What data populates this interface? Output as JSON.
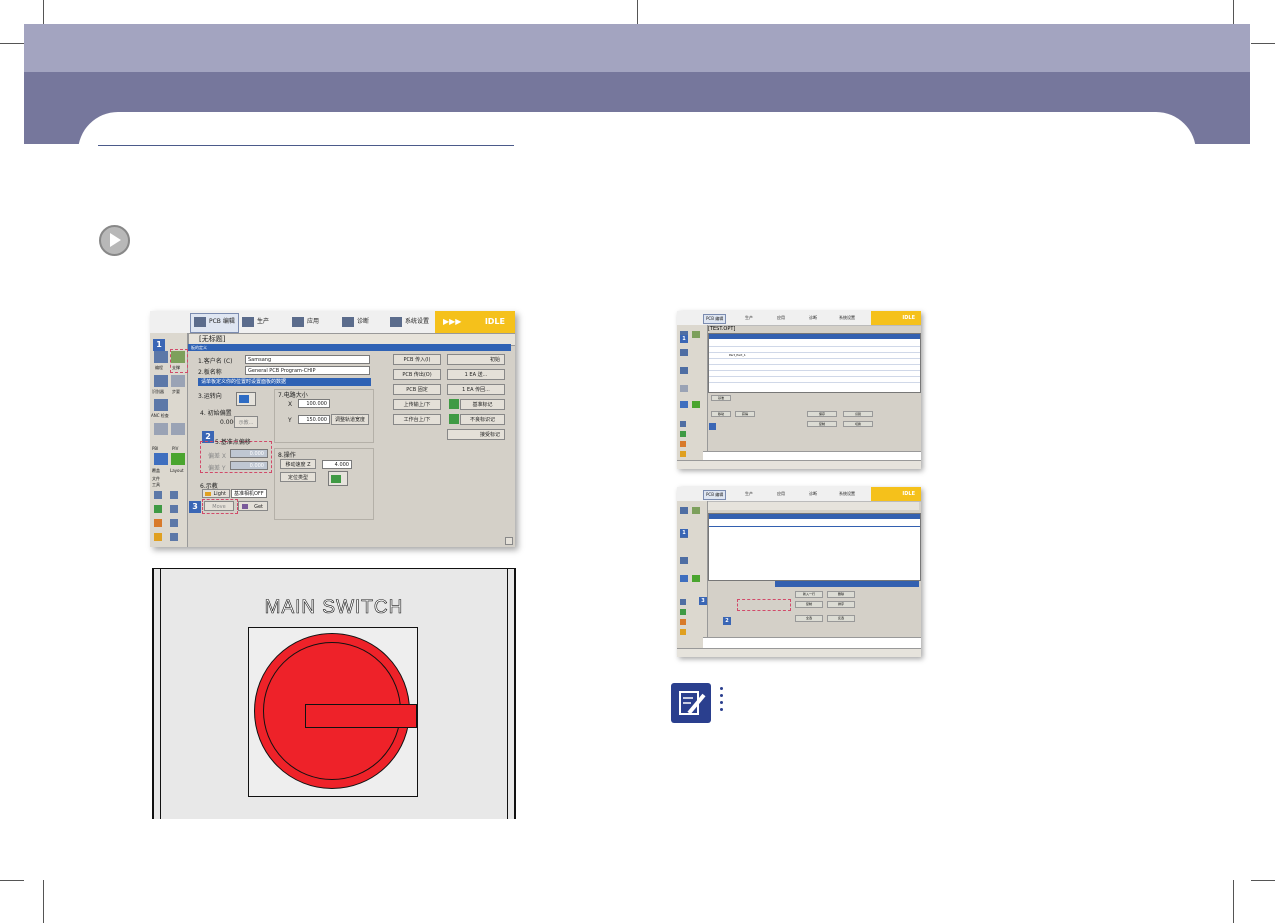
{
  "colors": {
    "band_light": "#a3a4c0",
    "band_dark": "#76779c",
    "accent_blue": "#2a3f8e",
    "switch_red": "#ee2229",
    "idle_yellow": "#f5c11b"
  },
  "screenshot1": {
    "toolbar": [
      "PCB 编辑",
      "生产",
      "应用",
      "诊断",
      "系统设置"
    ],
    "status": "IDLE",
    "status_arrows": "▶▶▶",
    "doc_title": "[无标题]",
    "panel_title": "板的定义",
    "sidebar_labels": [
      "编程",
      "支撑",
      "识别器",
      "步要",
      "ANC 检查",
      "PBI",
      "PIV",
      "覆盖",
      "Layout",
      "文件",
      "工具"
    ],
    "fields": {
      "customer_label": "1.客户名 (C)",
      "customer_value": "Samsang",
      "board_label": "2.板名称",
      "board_value": "General PCB Program-CHIP",
      "hint": "请单板定义你的位置时设置面板的数据",
      "direction_label": "3.运转向",
      "origin_label": "4. 初始偏置",
      "origin_value": "0.000",
      "origin_btn": "示教...",
      "size_label": "7.电路大小",
      "x_label": "X",
      "x_value": "100.000",
      "y_label": "Y",
      "y_value": "150.000",
      "adjust_btn": "调整轨道宽度",
      "fid_label": "5.基准点偏移",
      "offset_x_label": "偏差 X",
      "offset_x_value": "0.000",
      "offset_y_label": "偏差 Y",
      "offset_y_value": "0.000",
      "teach_label": "6.示教",
      "light_btn": "Light",
      "light_select": "基准相机OFF",
      "move_btn": "Move",
      "get_btn": "Get",
      "op_label": "8.操作",
      "z_label": "移动速度 Z",
      "z_value": "4.000",
      "type_btn": "定位类型"
    },
    "buttons_col1": [
      "PCB 传入(I)",
      "PCB 传出(O)",
      "PCB 固定",
      "上传输上/下",
      "工作台上/下"
    ],
    "buttons_col2": [
      "初始",
      "1 EA   送...",
      "1 EA   传回...",
      "基准标记",
      "不良标识记",
      "接受标记"
    ],
    "steps": [
      "1",
      "2",
      "3"
    ]
  },
  "main_switch": {
    "title": "MAIN  SWITCH"
  },
  "screenshot2": {
    "toolbar": [
      "PCB 编辑",
      "生产",
      "应用",
      "诊断",
      "系统设置"
    ],
    "status": "IDLE",
    "doc_title": "[TEST.OPT]",
    "row_label": "Part_Part_1",
    "buttons": [
      "基准",
      "移动",
      "获得",
      "保存",
      "识别",
      "复制",
      "切换"
    ],
    "steps": [
      "1"
    ]
  },
  "screenshot3": {
    "toolbar": [
      "PCB 编辑",
      "生产",
      "应用",
      "诊断",
      "系统设置"
    ],
    "status": "IDLE",
    "buttons": [
      "新入一行",
      "复制",
      "删除",
      "排序",
      "全选",
      "反选"
    ],
    "steps": [
      "1",
      "2",
      "3"
    ]
  }
}
